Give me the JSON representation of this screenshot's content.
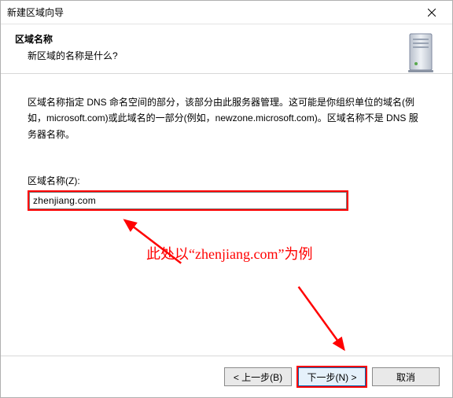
{
  "window": {
    "title": "新建区域向导"
  },
  "header": {
    "heading": "区域名称",
    "subheading": "新区域的名称是什么?"
  },
  "body": {
    "description": "区域名称指定 DNS 命名空间的部分，该部分由此服务器管理。这可能是你组织单位的域名(例如，microsoft.com)或此域名的一部分(例如，newzone.microsoft.com)。区域名称不是 DNS 服务器名称。",
    "field_label": "区域名称(Z):",
    "field_value": "zhenjiang.com",
    "annotation": "此处以“zhenjiang.com”为例"
  },
  "footer": {
    "back": "< 上一步(B)",
    "next": "下一步(N) >",
    "cancel": "取消"
  }
}
